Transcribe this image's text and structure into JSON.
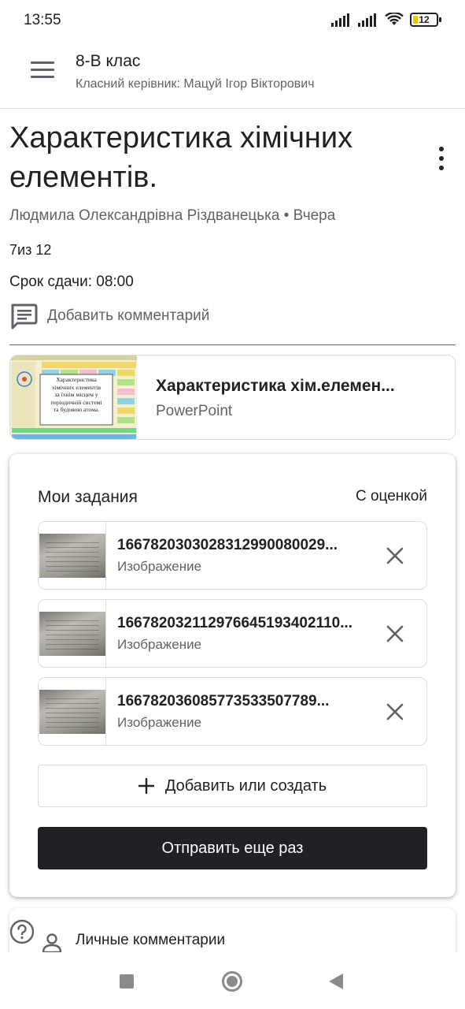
{
  "status_bar": {
    "time": "13:55",
    "battery": "12",
    "icons": [
      "signal-icon",
      "signal-icon",
      "wifi-icon",
      "battery-icon"
    ]
  },
  "app_bar": {
    "class_name": "8-В клас",
    "teacher_line": "Класний керівник: Мацуй Ігор Вікторович"
  },
  "assignment": {
    "title": "Характеристика хімічних елементів.",
    "author": "Людмила Олександрівна Різдванецька",
    "posted": "Вчера",
    "author_line": "Людмила Олександрівна Різдванецька • Вчера",
    "points": "7из 12",
    "due": "Срок сдачи: 08:00",
    "add_comment": "Добавить комментарий"
  },
  "material": {
    "title": "Характеристика хім.елемен...",
    "type": "PowerPoint",
    "thumb_text": [
      "Характеристика",
      "хімічних елементів",
      "за їхнім місцем у",
      "періодичній системі",
      "та будовою атома."
    ]
  },
  "my_work": {
    "title": "Мои задания",
    "status": "С оценкой",
    "files": [
      {
        "name": "1667820303028312990080029...",
        "type": "Изображение"
      },
      {
        "name": "166782032112976645193402110...",
        "type": "Изображение"
      },
      {
        "name": "166782036085773533507789...",
        "type": "Изображение"
      }
    ],
    "add_label": "Добавить или создать",
    "submit_label": "Отправить еще раз"
  },
  "private_comments": {
    "label": "Личные комментарии"
  },
  "colors": {
    "primary_text": "#202124",
    "secondary_text": "#5f6368",
    "border": "#dadce0",
    "submit_bg": "#202124",
    "battery_fill": "#f2c300"
  }
}
